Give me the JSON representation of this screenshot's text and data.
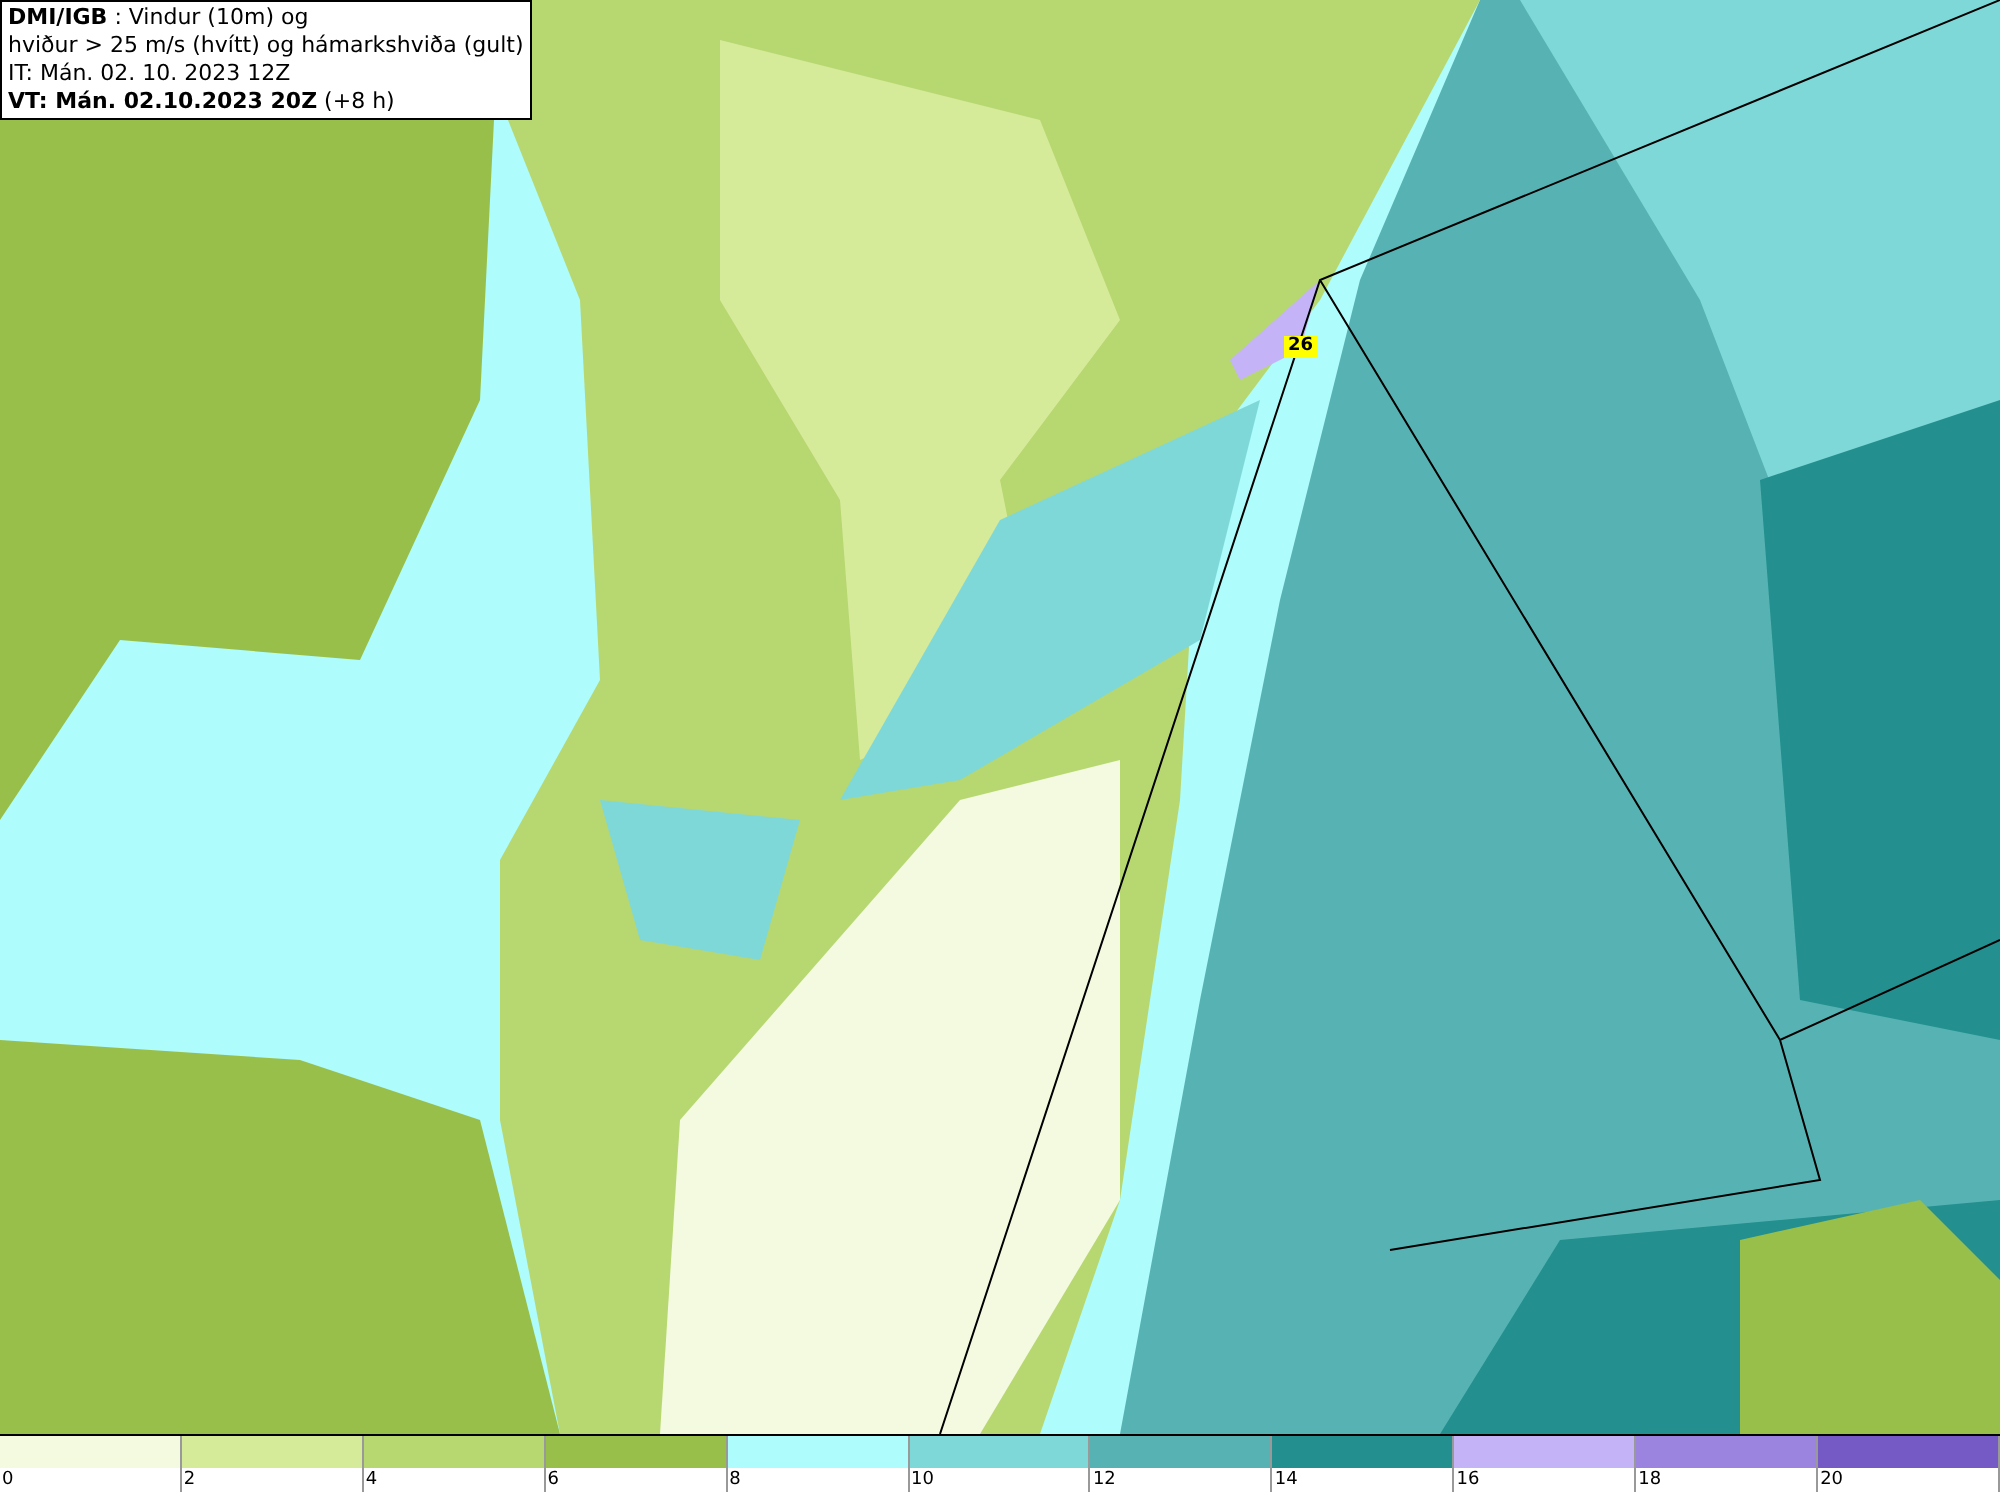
{
  "header": {
    "lines": [
      "**DMI/IGB** : Vindur (10m) og",
      "hviður > 25 m/s (hvítt) og hámarkshviða (gult)",
      "IT: Mán. 02. 10. 2023 12Z",
      "**VT: Mán. 02.10.2023 20Z** (+8 h)"
    ]
  },
  "map": {
    "max_gust_label": "26"
  },
  "legend": {
    "segments": [
      {
        "label": "0",
        "color": "#f4fae0"
      },
      {
        "label": "2",
        "color": "#d6eb9a"
      },
      {
        "label": "4",
        "color": "#b7d771"
      },
      {
        "label": "6",
        "color": "#98bf4a"
      },
      {
        "label": "8",
        "color": "#aefcfb"
      },
      {
        "label": "10",
        "color": "#7fd8d8"
      },
      {
        "label": "12",
        "color": "#57b3b3"
      },
      {
        "label": "14",
        "color": "#238f8f"
      },
      {
        "label": "16",
        "color": "#c4b4f7"
      },
      {
        "label": "18",
        "color": "#9b84e0"
      },
      {
        "label": "20",
        "color": "#7559c4"
      }
    ]
  }
}
